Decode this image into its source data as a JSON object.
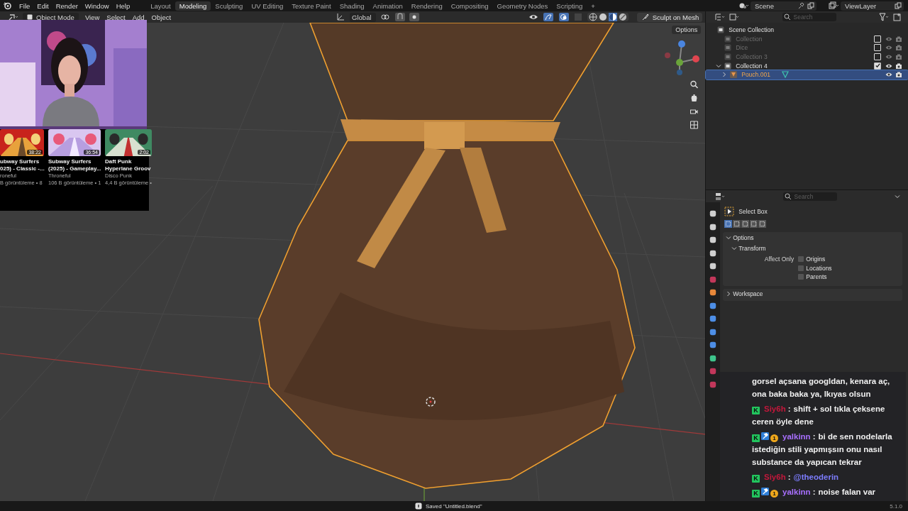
{
  "topbar": {
    "menu": [
      "File",
      "Edit",
      "Render",
      "Window",
      "Help"
    ],
    "workspaces": [
      {
        "label": "Layout",
        "selected": false
      },
      {
        "label": "Modeling",
        "selected": true
      },
      {
        "label": "Sculpting",
        "selected": false
      },
      {
        "label": "UV Editing",
        "selected": false
      },
      {
        "label": "Texture Paint",
        "selected": false
      },
      {
        "label": "Shading",
        "selected": false
      },
      {
        "label": "Animation",
        "selected": false
      },
      {
        "label": "Rendering",
        "selected": false
      },
      {
        "label": "Compositing",
        "selected": false
      },
      {
        "label": "Geometry Nodes",
        "selected": false
      },
      {
        "label": "Scripting",
        "selected": false
      }
    ],
    "add_tab": "+",
    "scene": "Scene",
    "view_layer": "ViewLayer"
  },
  "viewport": {
    "mode": "Object Mode",
    "menu": [
      "View",
      "Select",
      "Add",
      "Object"
    ],
    "orientation": "Global",
    "sculpt_button": "Sculpt on Mesh",
    "options": "Options"
  },
  "videos": [
    {
      "duration": "38:22",
      "title": [
        "ubway Surfers",
        "025) - Classic -..."
      ],
      "channel": "roneful",
      "views": "B görüntüleme • 8"
    },
    {
      "duration": "36:54",
      "title": [
        "Subway Surfers",
        "(2025) - Gameplay..."
      ],
      "channel": "Throneful",
      "views": "106 B görüntüleme • 1"
    },
    {
      "duration": "2:02",
      "title": [
        "Daft Punk",
        "Hyperlane Groov"
      ],
      "channel": "Disco Punk",
      "views": "4,4 B görüntüleme •"
    }
  ],
  "outliner": {
    "search": {
      "placeholder": "Search"
    },
    "tree": {
      "label": "Scene Collection",
      "children": [
        {
          "kind": "collection",
          "label": "Collection",
          "checked": false,
          "selected": false
        },
        {
          "kind": "collection",
          "label": "Dice",
          "checked": false,
          "selected": false
        },
        {
          "kind": "collection",
          "label": "Collection 3",
          "checked": false,
          "selected": false
        },
        {
          "kind": "collection",
          "label": "Collection 4",
          "checked": true,
          "selected": false,
          "expanded": true,
          "children": [
            {
              "kind": "object",
              "label": "Pouch.001",
              "selected": true,
              "expanded": false
            }
          ]
        }
      ]
    }
  },
  "properties": {
    "search": {
      "placeholder": "Search"
    },
    "tool": "Select Box",
    "modes": [
      {
        "selected": true
      },
      {
        "selected": false
      },
      {
        "selected": false
      },
      {
        "selected": false
      },
      {
        "selected": false
      }
    ],
    "options_panel": {
      "title": "Options",
      "expanded": true,
      "transform": {
        "title": "Transform",
        "expanded": true,
        "label": "Affect Only",
        "checkboxes": [
          {
            "label": "Origins",
            "checked": false
          },
          {
            "label": "Locations",
            "checked": false
          },
          {
            "label": "Parents",
            "checked": false
          }
        ]
      }
    },
    "workspace_panel": {
      "title": "Workspace",
      "expanded": false
    }
  },
  "chat": [
    {
      "lines": [
        "gorsel açsana googldan, kenara aç,",
        "ona baka baka ya, lkıyas olsun"
      ]
    },
    {
      "badges": [
        {
          "kind": "square",
          "label": "K"
        }
      ],
      "user": "Siy6h",
      "color": "#c3173b",
      "colon": ":",
      "lines": [
        "shift + sol tıkla çeksene",
        "ceren öyle dene"
      ],
      "mention": false
    },
    {
      "badges": [
        {
          "kind": "square",
          "label": "K"
        },
        {
          "kind": "hammer"
        },
        {
          "kind": "coin",
          "label": "1"
        }
      ],
      "user": "yalkinn",
      "color": "#a970ff",
      "colon": ":",
      "lines": [
        "bi de sen nodelarla",
        "istediğin stili yapmışsın onu nasıl",
        "substance da yapıcan tekrar"
      ],
      "mention": false
    },
    {
      "badges": [
        {
          "kind": "square",
          "label": "K"
        }
      ],
      "user": "Siy6h",
      "color": "#c3173b",
      "colon": ":",
      "lines": [
        "@theoderin"
      ],
      "mention": true
    },
    {
      "badges": [
        {
          "kind": "square",
          "label": "K"
        },
        {
          "kind": "hammer"
        },
        {
          "kind": "coin",
          "label": "1"
        }
      ],
      "user": "yalkinn",
      "color": "#a970ff",
      "colon": ":",
      "lines": [
        "noise falan var"
      ],
      "mention": false
    }
  ],
  "status": "Saved \"Untitled.blend\"",
  "version": "5.1.0"
}
